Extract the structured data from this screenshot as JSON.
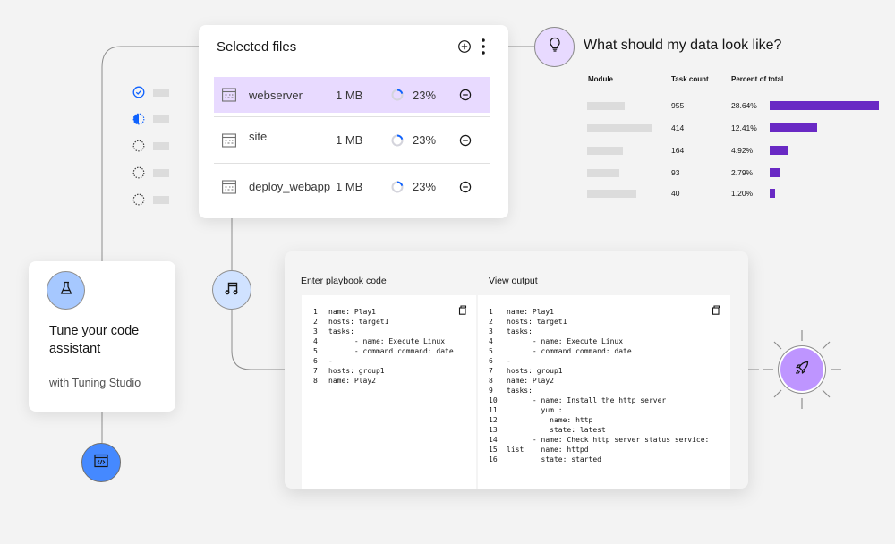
{
  "steps": [
    {
      "status": "complete"
    },
    {
      "status": "in-progress"
    },
    {
      "status": "not-started"
    },
    {
      "status": "not-started"
    },
    {
      "status": "not-started"
    }
  ],
  "files_card": {
    "title": "Selected files",
    "add_icon": "add-circle-icon",
    "menu_icon": "overflow-menu-vertical-icon",
    "files": [
      {
        "name": "webserver",
        "size": "1 MB",
        "progress": "23%",
        "progress_value": 0.23,
        "selected": true
      },
      {
        "name": "site",
        "size": "1 MB",
        "progress": "23%",
        "progress_value": 0.23,
        "selected": false
      },
      {
        "name": "deploy_webapp",
        "size": "1 MB",
        "progress": "23%",
        "progress_value": 0.23,
        "selected": false
      }
    ]
  },
  "data_section": {
    "title": "What should my data look like?",
    "icon": "lightbulb-icon",
    "columns": [
      "Module",
      "Task count",
      "Percent of total"
    ],
    "rows": [
      {
        "count": "955",
        "percent": "28.64%",
        "percent_value": 28.64
      },
      {
        "count": "414",
        "percent": "12.41%",
        "percent_value": 12.41
      },
      {
        "count": "164",
        "percent": "4.92%",
        "percent_value": 4.92
      },
      {
        "count": "93",
        "percent": "2.79%",
        "percent_value": 2.79
      },
      {
        "count": "40",
        "percent": "1.20%",
        "percent_value": 1.2
      }
    ],
    "bar_color": "#6929c4"
  },
  "tune_card": {
    "title": "Tune your code assistant",
    "subtitle": "with Tuning Studio",
    "icon": "chemistry-flask-icon"
  },
  "code_panel": {
    "input_label": "Enter playbook code",
    "output_label": "View output",
    "input_lines": [
      {
        "n": "1",
        "text": "name: Play1"
      },
      {
        "n": "2",
        "text": "hosts: target1"
      },
      {
        "n": "3",
        "text": "tasks:"
      },
      {
        "n": "4",
        "text": "      - name: Execute Linux"
      },
      {
        "n": "5",
        "text": "      - command command: date"
      },
      {
        "n": "6",
        "text": "-"
      },
      {
        "n": "7",
        "text": "hosts: group1"
      },
      {
        "n": "8",
        "text": "name: Play2"
      }
    ],
    "output_lines": [
      {
        "n": "1",
        "text": "name: Play1"
      },
      {
        "n": "2",
        "text": "hosts: target1"
      },
      {
        "n": "3",
        "text": "tasks:"
      },
      {
        "n": "4",
        "text": "      - name: Execute Linux"
      },
      {
        "n": "5",
        "text": "      - command command: date"
      },
      {
        "n": "6",
        "text": "-"
      },
      {
        "n": "7",
        "text": "hosts: group1"
      },
      {
        "n": "8",
        "text": "name: Play2"
      },
      {
        "n": "9",
        "text": "tasks:"
      },
      {
        "n": "10",
        "text": "      - name: Install the http server"
      },
      {
        "n": "11",
        "text": "        yum :"
      },
      {
        "n": "12",
        "text": "          name: http"
      },
      {
        "n": "13",
        "text": "          state: latest"
      },
      {
        "n": "14",
        "text": "      - name: Check http server status service:"
      },
      {
        "n": "15",
        "text": "list    name: httpd"
      },
      {
        "n": "16",
        "text": "        state: started"
      }
    ]
  },
  "nodes": {
    "music": "music-icon",
    "code": "code-window-icon",
    "rocket": "rocket-icon"
  },
  "colors": {
    "accent_purple": "#6929c4",
    "selected_row": "#e8daff",
    "blue": "#0f62fe"
  }
}
